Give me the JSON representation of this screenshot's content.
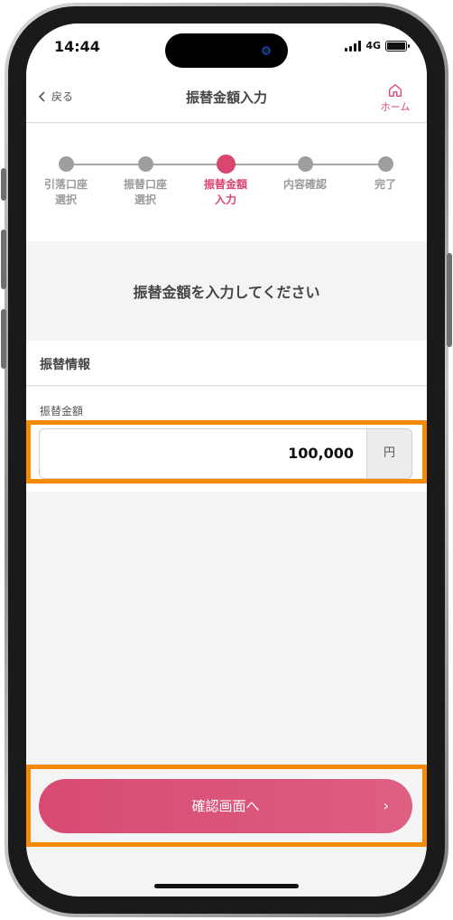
{
  "status_bar": {
    "time": "14:44",
    "network": "4G"
  },
  "nav": {
    "back_label": "戻る",
    "title": "振替金額入力",
    "home_label": "ホーム"
  },
  "stepper": {
    "steps": [
      {
        "label": "引落口座\n選択",
        "active": false
      },
      {
        "label": "振替口座\n選択",
        "active": false
      },
      {
        "label": "振替金額\n入力",
        "active": true
      },
      {
        "label": "内容確認",
        "active": false
      },
      {
        "label": "完了",
        "active": false
      }
    ]
  },
  "headline": "振替金額を入力してください",
  "section": {
    "title": "振替情報",
    "field_label": "振替金額",
    "amount_value": "100,000",
    "amount_unit": "円"
  },
  "confirm_button": {
    "label": "確認画面へ",
    "chevron": "›"
  },
  "colors": {
    "accent": "#d9466f",
    "highlight": "#f58a07"
  },
  "icons": [
    "chevron-left-icon",
    "home-icon",
    "chevron-right-icon",
    "signal-icon",
    "battery-icon"
  ]
}
